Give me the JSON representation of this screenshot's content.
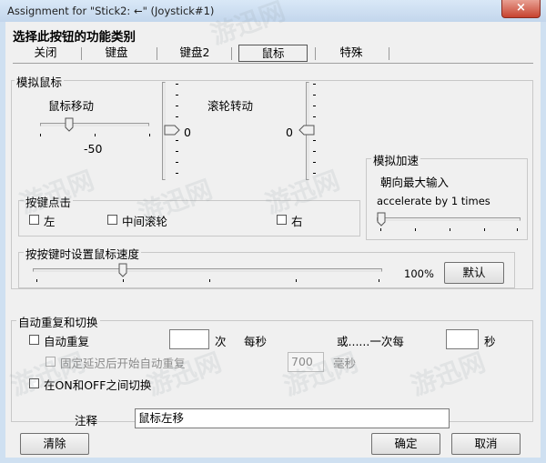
{
  "window": {
    "title": "Assignment for \"Stick2: ←\" (Joystick#1)",
    "close_glyph": "×"
  },
  "heading": "选择此按钮的功能类别",
  "tabs": [
    "关闭",
    "键盘",
    "键盘2",
    "鼠标",
    "特殊"
  ],
  "active_tab": "鼠标",
  "mouse_group": {
    "label": "模拟鼠标",
    "move_label": "鼠标移动",
    "move_value": "-50",
    "scroll_label": "滚轮转动",
    "v_left_value": "0",
    "v_right_value": "0"
  },
  "accel_group": {
    "label": "模拟加速",
    "max_input_label": "朝向最大输入",
    "accelerate_text": "accelerate by 1 times"
  },
  "click_group": {
    "label": "按键点击",
    "left": "左",
    "middle": "中间滚轮",
    "right": "右"
  },
  "speed_group": {
    "label": "按按键时设置鼠标速度",
    "percent": "100%",
    "default_button": "默认"
  },
  "repeat_group": {
    "label": "自动重复和切换",
    "auto_repeat": "自动重复",
    "times_unit": "次",
    "per_second": "每秒",
    "or_once_every": "或......一次每",
    "seconds_unit": "秒",
    "delay_label": "固定延迟后开始自动重复",
    "delay_value": "700",
    "ms_unit": "毫秒",
    "toggle_label": "在ON和OFF之间切换"
  },
  "comment": {
    "label": "注释",
    "value": "鼠标左移"
  },
  "buttons": {
    "clear": "清除",
    "ok": "确定",
    "cancel": "取消"
  },
  "watermark_text": "游迅网"
}
